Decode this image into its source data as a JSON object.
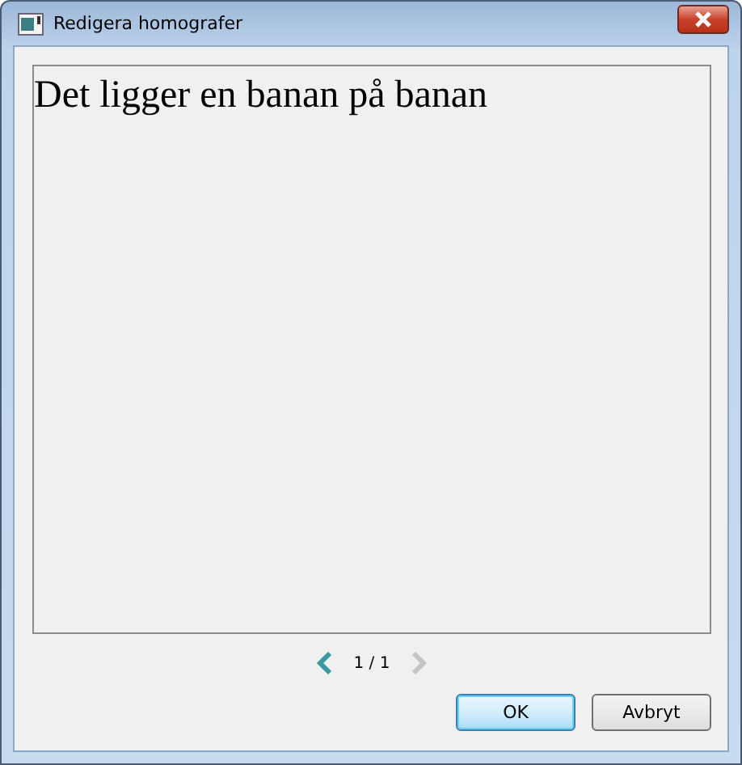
{
  "window": {
    "title": "Redigera homografer"
  },
  "editor": {
    "text": "Det ligger en banan på banan"
  },
  "pager": {
    "previous": {
      "disabled": false
    },
    "page": "1 / 1",
    "next": {
      "disabled": true
    }
  },
  "buttons": [
    {
      "label": "OK",
      "default": true
    },
    {
      "label": "Avbryt",
      "default": false
    }
  ]
}
